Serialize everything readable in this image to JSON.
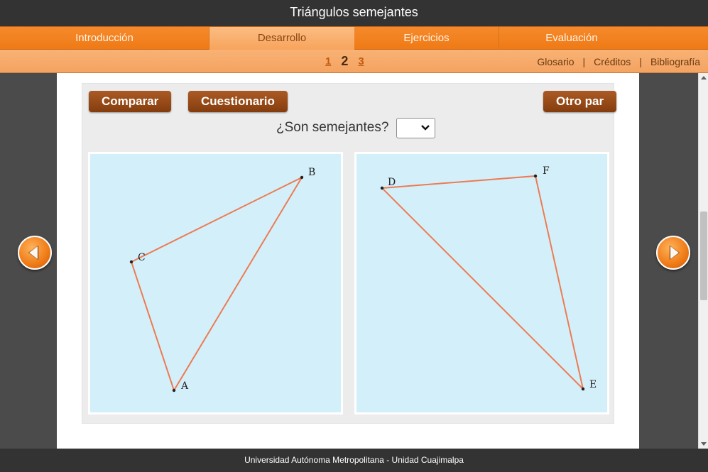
{
  "app": {
    "title": "Triángulos semejantes"
  },
  "tabs": [
    {
      "label": "Introducción"
    },
    {
      "label": "Desarrollo"
    },
    {
      "label": "Ejercicios"
    },
    {
      "label": "Evaluación"
    }
  ],
  "pages": [
    "1",
    "2",
    "3"
  ],
  "links": {
    "glossary": "Glosario",
    "credits": "Créditos",
    "bibliography": "Bibliografía"
  },
  "buttons": {
    "compare": "Comparar",
    "quiz": "Cuestionario",
    "other_pair": "Otro par"
  },
  "question": {
    "text": "¿Son semejantes?",
    "selected": ""
  },
  "triangle_left": {
    "labels": {
      "a": "A",
      "b": "B",
      "c": "C"
    }
  },
  "triangle_right": {
    "labels": {
      "d": "D",
      "e": "E",
      "f": "F"
    }
  },
  "colors": {
    "accent": "#ef7a16",
    "button": "#95461a",
    "triangle_stroke": "#ee7a52",
    "canvas_bg": "#d3f0fa"
  },
  "footer": {
    "text": "Universidad Autónoma Metropolitana - Unidad Cuajimalpa"
  }
}
